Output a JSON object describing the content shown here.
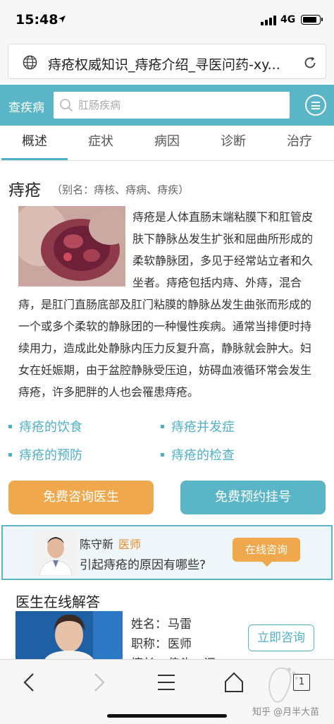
{
  "status_bar": {
    "time": "15:48",
    "network": "4G",
    "battery_level": 0.9
  },
  "browser": {
    "url_text": "痔疮权威知识_痔疮介绍_寻医问药-xy..."
  },
  "site_header": {
    "search_label": "查疾病",
    "search_placeholder": "肛肠疾病"
  },
  "tabs": [
    {
      "label": "概述",
      "active": true
    },
    {
      "label": "症状",
      "active": false
    },
    {
      "label": "病因",
      "active": false
    },
    {
      "label": "诊断",
      "active": false
    },
    {
      "label": "治疗",
      "active": false
    }
  ],
  "article": {
    "title": "痔疮",
    "aliases": "（别名：痔核、痔病、痔疾）",
    "lines": [
      "痔疮是人体直肠末端粘膜下和肛管皮",
      "肤下静脉丛发生扩张和屈曲所形成的",
      "柔软静脉团，多见于经常站立者和久",
      "坐者。痔疮包括内痔、外痔，混合",
      "痔，是肛门直肠底部及肛门粘膜的静脉丛发生曲张而形成的",
      "一个或多个柔软的静脉团的一种慢性疾病。通常当排便时持",
      "续用力，造成此处静脉内压力反复升高，静脉就会肿大。妇",
      "女在妊娠期，由于盆腔静脉受压迫，妨碍血液循环常会发生",
      "痔疮，许多肥胖的人也会罹患痔疮。"
    ]
  },
  "topic_links": [
    "痔疮的饮食",
    "痔疮并发症",
    "痔疮的预防",
    "痔疮的检查"
  ],
  "actions": {
    "consult": "免费咨询医生",
    "appointment": "免费预约挂号"
  },
  "consult_card": {
    "doctor_name": "陈守新",
    "doctor_title": "医师",
    "question": "引起痔疮的原因有哪些?",
    "button": "在线咨询"
  },
  "online_answers": {
    "title": "医生在线解答",
    "rows": [
      {
        "label": "姓名：",
        "value": "马雷"
      },
      {
        "label": "职称：",
        "value": "医师"
      },
      {
        "label": "擅长：",
        "value": "偏头、闭"
      }
    ],
    "button": "立即咨询"
  },
  "toolbar": {
    "tab_count": "1"
  },
  "watermark": "知乎 @月半大苗",
  "colors": {
    "brand_teal": "#5ab5c6",
    "link": "#4fb0c6",
    "orange": "#f0a84c",
    "role_orange": "#f08c2c"
  }
}
